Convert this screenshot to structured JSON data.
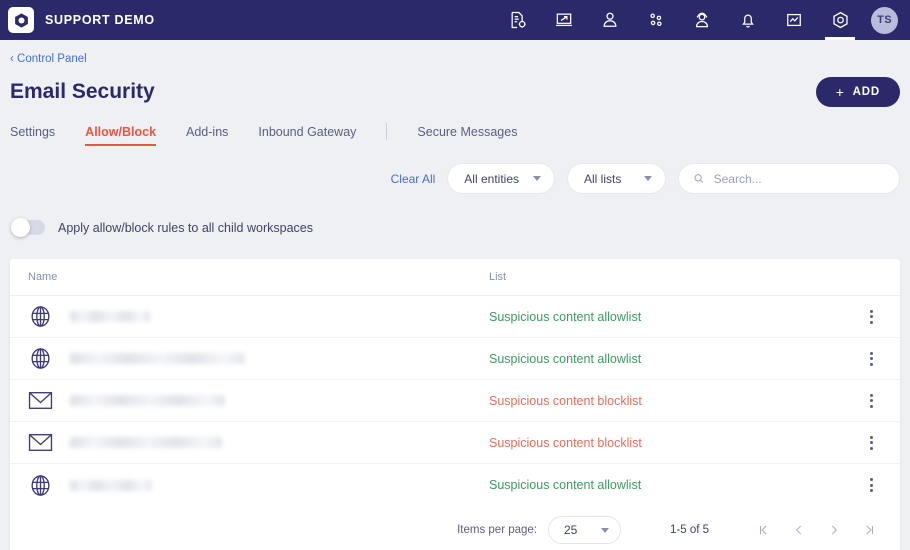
{
  "topbar": {
    "brand_name": "SUPPORT DEMO",
    "logo_icon": "hexagon-logo-icon",
    "nav_icons": [
      {
        "name": "document-settings-icon",
        "label": "Reports"
      },
      {
        "name": "device-screen-icon",
        "label": "Devices"
      },
      {
        "name": "user-icon",
        "label": "Users"
      },
      {
        "name": "network-nodes-icon",
        "label": "Network"
      },
      {
        "name": "support-agent-icon",
        "label": "Support"
      },
      {
        "name": "bell-icon",
        "label": "Notifications"
      },
      {
        "name": "chart-box-icon",
        "label": "Analytics"
      },
      {
        "name": "settings-gear-icon",
        "label": "Settings",
        "active": true
      }
    ],
    "avatar_initials": "TS"
  },
  "header": {
    "breadcrumb": "‹ Control Panel",
    "title": "Email Security",
    "add_button": "ADD",
    "add_icon": "plus-icon"
  },
  "tabs": [
    {
      "label": "Settings",
      "active": false
    },
    {
      "label": "Allow/Block",
      "active": true
    },
    {
      "label": "Add-ins",
      "active": false
    },
    {
      "label": "Inbound Gateway",
      "active": false
    },
    {
      "label": "Secure Messages",
      "active": false,
      "after_separator": true
    }
  ],
  "filters": {
    "clear_all": "Clear All",
    "entity_filter": "All entities",
    "list_filter": "All lists",
    "search_placeholder": "Search...",
    "search_value": "",
    "search_icon": "search-icon"
  },
  "toggle": {
    "label": "Apply allow/block rules to all child workspaces",
    "enabled": false
  },
  "table": {
    "columns": {
      "name": "Name",
      "list": "List"
    },
    "rows": [
      {
        "icon": "globe-icon",
        "name": "",
        "redacted": true,
        "redacted_width": 80,
        "list": "Suspicious content allowlist",
        "list_type": "allow"
      },
      {
        "icon": "globe-icon",
        "name": "",
        "redacted": true,
        "redacted_width": 175,
        "list": "Suspicious content allowlist",
        "list_type": "allow"
      },
      {
        "icon": "envelope-icon",
        "name": "",
        "redacted": true,
        "redacted_width": 155,
        "list": "Suspicious content blocklist",
        "list_type": "block"
      },
      {
        "icon": "envelope-icon",
        "name": "",
        "redacted": true,
        "redacted_width": 152,
        "list": "Suspicious content blocklist",
        "list_type": "block"
      },
      {
        "icon": "globe-icon",
        "name": "",
        "redacted": true,
        "redacted_width": 82,
        "list": "Suspicious content allowlist",
        "list_type": "allow"
      }
    ],
    "row_menu_icon": "kebab-menu-icon"
  },
  "pagination": {
    "items_per_page_label": "Items per page:",
    "items_per_page_value": "25",
    "range_text": "1-5 of 5",
    "first_icon": "first-page-icon",
    "prev_icon": "previous-page-icon",
    "next_icon": "next-page-icon",
    "last_icon": "last-page-icon"
  },
  "colors": {
    "nav_background": "#2a2a6b",
    "accent_active_tab": "#e8573f",
    "allowlist": "#3f9a63",
    "blocklist": "#e2705d",
    "link": "#4a6fc4",
    "page_background": "#eef0f4"
  }
}
